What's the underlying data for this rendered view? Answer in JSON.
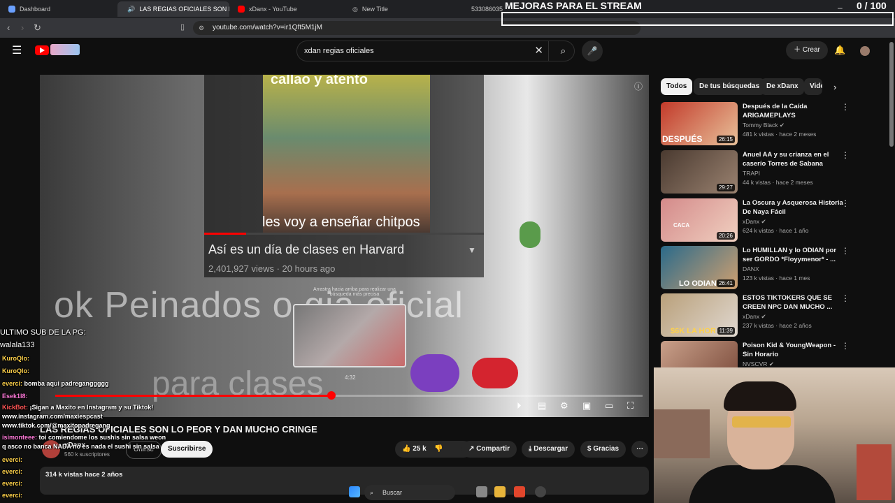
{
  "browser": {
    "tabs": [
      {
        "label": "Dashboard",
        "active": false
      },
      {
        "label": "LAS REGIAS OFICIALES SON L",
        "active": true
      },
      {
        "label": "xDanx - YouTube",
        "active": false
      },
      {
        "label": "New Title",
        "active": false
      },
      {
        "label": "533086035",
        "active": false
      }
    ],
    "url": "youtube.com/watch?v=ir1Qft5M1jM"
  },
  "youtube": {
    "search_value": "xdan regias oficiales",
    "create_label": "Crear",
    "chips": [
      "Todos",
      "De tus búsquedas",
      "De xDanx",
      "Vide"
    ],
    "player": {
      "overlay_top_text": "callao y atento",
      "overlay_caption": "les voy a enseñar chitpos",
      "inner_title": "Así es un día de clases en Harvard",
      "inner_meta": "2,401,927 views · 20 hours ago",
      "big_text_1": "ok Peinados  o    gia oficial",
      "big_text_2": "para clases",
      "seek_hint": "Arrastra hacia arriba para realizar una búsqueda más precisa",
      "preview_time": "4:32",
      "progress_fraction": 0.47
    },
    "video": {
      "title": "LAS REGIAS OFICIALES SON LO PEOR Y DAN MUCHO CRINGE",
      "channel": "xDanx",
      "subscribers": "560 k suscriptores",
      "join_label": "Unirse",
      "subscribe_label": "Suscribirse",
      "likes": "25 k",
      "share_label": "Compartir",
      "download_label": "Descargar",
      "thanks_label": "Gracias",
      "views_line": "314 k vistas  hace 2 años"
    },
    "recommendations": [
      {
        "title": "Después de la Caída ARIGAMEPLAYS",
        "channel": "Tommy Black",
        "meta": "481 k vistas · hace 2 meses",
        "duration": "26:15",
        "thumb_text": "DESPUÉS",
        "color": "#c23a2a"
      },
      {
        "title": "Anuel AA y su crianza en el caserío Torres de Sabana",
        "channel": "TRAPI",
        "meta": "44 k vistas · hace 2 meses",
        "duration": "29:27",
        "thumb_text": "",
        "color": "#4a3a30"
      },
      {
        "title": "La Oscura y Asquerosa Historia De Naya Fácil",
        "channel": "xDanx",
        "meta": "624 k vistas · hace 1 año",
        "duration": "20:26",
        "thumb_text": "CACA",
        "color": "#d48a8a"
      },
      {
        "title": "Lo HUMILLAN y lo ODIAN por ser GORDO *Floyymenor* - ...",
        "channel": "DANX",
        "meta": "123 k vistas · hace 1 mes",
        "duration": "26:41",
        "thumb_text": "LO ODIAN",
        "color": "#2a6a8a"
      },
      {
        "title": "ESTOS TIKTOKERS QUE SE CREEN NPC DAN MUCHO ...",
        "channel": "xDanx",
        "meta": "237 k vistas · hace 2 años",
        "duration": "11:39",
        "thumb_text": "$6K LA HOR",
        "color": "#b9a07a"
      },
      {
        "title": "Poison Kid & YoungWeapon - Sin Horario",
        "channel": "NVSCVR",
        "meta": "",
        "duration": "",
        "thumb_text": "",
        "color": "#c9a08a"
      }
    ]
  },
  "stream": {
    "title": "MEJORAS PARA EL STREAM",
    "counter": "0 / 100"
  },
  "chat": {
    "header1": "ULTIMO SUB DE LA PG:",
    "header2": "walala133",
    "lines": [
      {
        "user": "KuroQlo:",
        "msg": ""
      },
      {
        "user": "KuroQlo:",
        "msg": ""
      },
      {
        "user": "everci:",
        "msg": "bomba aqui padreganggggg"
      },
      {
        "user": "Esek1l8:",
        "msg": ""
      },
      {
        "user": "KickBot:",
        "msg": "¡Sigan a Maxito en Instagram y su Tiktok! "
      },
      {
        "user": "",
        "msg": "www.instagram.com/maxiespcast"
      },
      {
        "user": "",
        "msg": "www.tiktok.com/@maxitopadregang"
      },
      {
        "user": "isimonteee:",
        "msg": "toi comiendome los sushis sin salsa weon"
      },
      {
        "user": "",
        "msg": "q asco no banca NADA no es nada el sushi sin salsa"
      },
      {
        "user": "everci:",
        "msg": ""
      },
      {
        "user": "everci:",
        "msg": ""
      },
      {
        "user": "everci:",
        "msg": ""
      },
      {
        "user": "everci:",
        "msg": ""
      }
    ]
  },
  "taskbar": {
    "search_label": "Buscar"
  }
}
